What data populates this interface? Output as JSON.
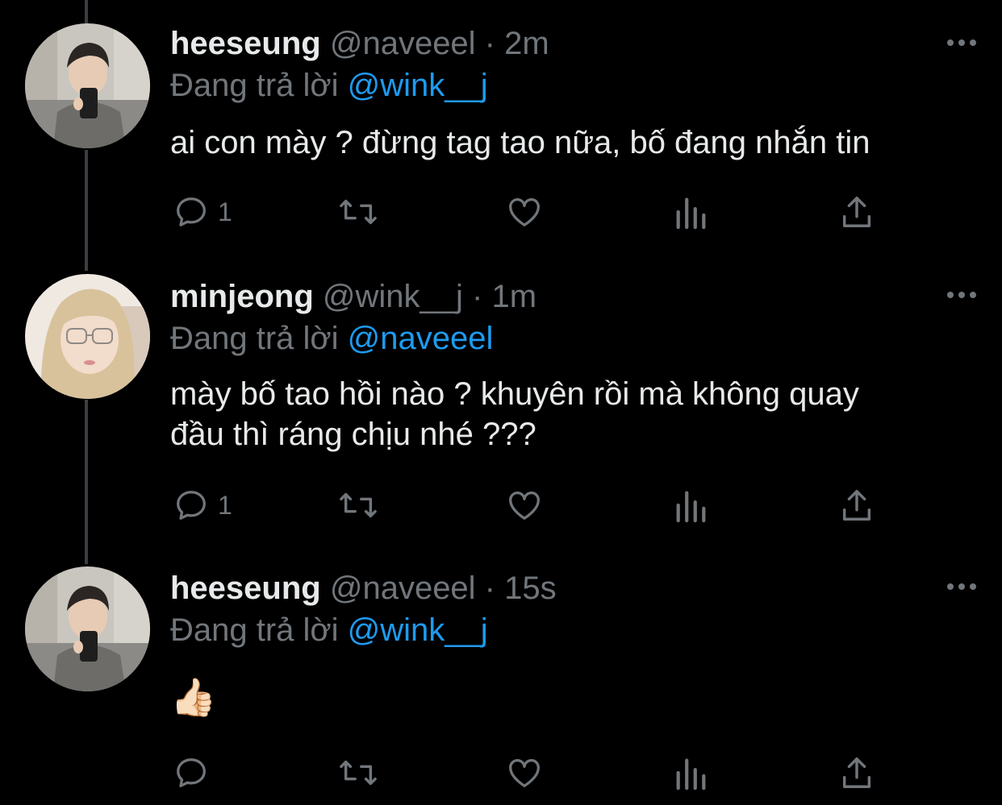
{
  "tweets": [
    {
      "display_name": "heeseung",
      "meta": "@naveeel · 2m",
      "reply_prefix": "Đang trả lời",
      "reply_to": "@wink__j",
      "text": "ai con mày ? đừng tag tao nữa, bố đang nhắn tin",
      "reply_count": "1",
      "avatar": "avatar-male"
    },
    {
      "display_name": "minjeong",
      "meta": "@wink__j · 1m",
      "reply_prefix": "Đang trả lời",
      "reply_to": "@naveeel",
      "text_line1": "mày bố tao hồi nào ? khuyên rồi mà không quay",
      "text_line2": "đầu thì ráng chịu nhé ???",
      "reply_count": "1",
      "avatar": "avatar-female"
    },
    {
      "display_name": "heeseung",
      "meta": "@naveeel · 15s",
      "reply_prefix": "Đang trả lời",
      "reply_to": "@wink__j",
      "text": "👍🏻",
      "reply_count": "",
      "avatar": "avatar-male"
    }
  ],
  "icons": {
    "more": "more-horizontal-icon",
    "reply": "reply-bubble-icon",
    "retweet": "retweet-icon",
    "like": "heart-icon",
    "views": "analytics-bars-icon",
    "share": "share-upload-icon"
  },
  "colors": {
    "background": "#000000",
    "text": "#e7e9ea",
    "secondary": "#71767b",
    "link": "#1d9bf0",
    "thread_line": "#3a3e42"
  }
}
